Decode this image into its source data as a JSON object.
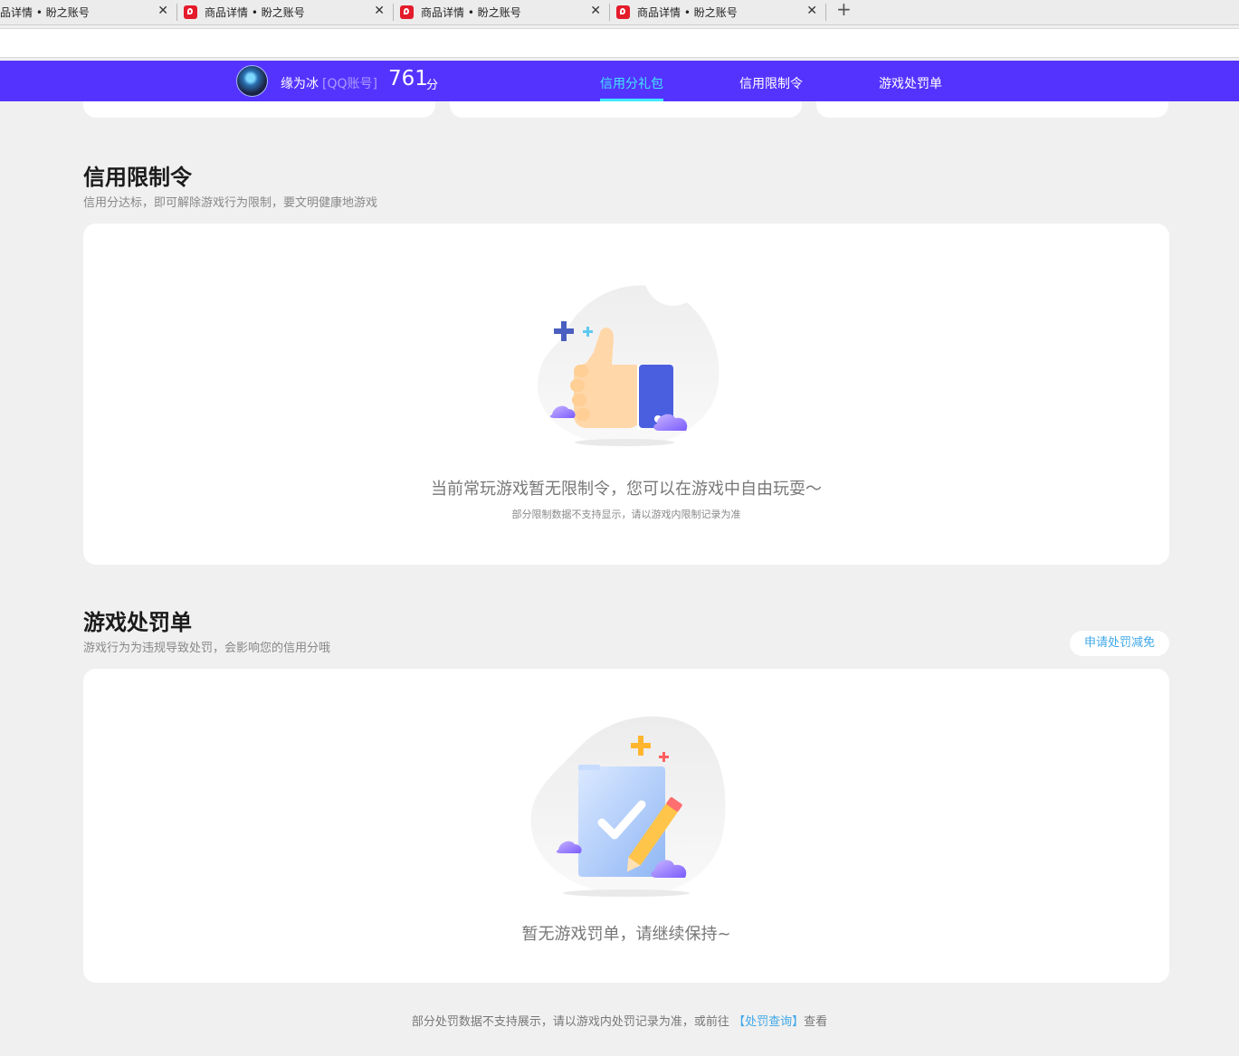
{
  "browser": {
    "tabs": [
      {
        "title": "品详情 • 盼之账号"
      },
      {
        "title": "商品详情 • 盼之账号"
      },
      {
        "title": "商品详情 • 盼之账号"
      },
      {
        "title": "商品详情 • 盼之账号"
      }
    ],
    "close_glyph": "✕",
    "new_tab_glyph": "+"
  },
  "header": {
    "username": "缘为冰",
    "account_type": "[QQ账号]",
    "score": "761",
    "score_unit": "分",
    "nav": [
      {
        "label": "信用分礼包",
        "active": true
      },
      {
        "label": "信用限制令",
        "active": false
      },
      {
        "label": "游戏处罚单",
        "active": false
      }
    ]
  },
  "restriction": {
    "title": "信用限制令",
    "subtitle": "信用分达标，即可解除游戏行为限制，要文明健康地游戏",
    "empty_text": "当前常玩游戏暂无限制令，您可以在游戏中自由玩耍～",
    "note": "部分限制数据不支持显示，请以游戏内限制记录为准"
  },
  "penalty": {
    "title": "游戏处罚单",
    "subtitle": "游戏行为为违规导致处罚，会影响您的信用分哦",
    "appeal_button": "申请处罚减免",
    "empty_text": "暂无游戏罚单，请继续保持~"
  },
  "footer": {
    "text_before": "部分处罚数据不支持展示，请以游戏内处罚记录为准，或前往",
    "link": "【处罚查询】",
    "text_after": "查看"
  },
  "colors": {
    "brand": "#5533ff",
    "active_nav": "#40e8ff",
    "link": "#3fa8e8"
  }
}
